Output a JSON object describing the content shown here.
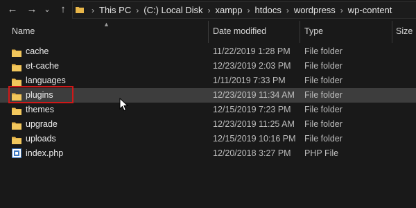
{
  "toolbar": {
    "back_icon": "arrow-left-icon",
    "forward_icon": "arrow-right-icon",
    "recent_icon": "chevron-down-icon",
    "up_icon": "arrow-up-icon"
  },
  "address_bar": {
    "breadcrumbs": [
      "This PC",
      "(C:) Local Disk",
      "xampp",
      "htdocs",
      "wordpress",
      "wp-content"
    ]
  },
  "columns": {
    "name": "Name",
    "date": "Date modified",
    "type": "Type",
    "size": "Size"
  },
  "files": [
    {
      "name": "cache",
      "date": "11/22/2019 1:28 PM",
      "type": "File folder",
      "icon": "folder-icon"
    },
    {
      "name": "et-cache",
      "date": "12/23/2019 2:03 PM",
      "type": "File folder",
      "icon": "folder-icon"
    },
    {
      "name": "languages",
      "date": "1/11/2019 7:33 PM",
      "type": "File folder",
      "icon": "folder-icon"
    },
    {
      "name": "plugins",
      "date": "12/23/2019 11:34 AM",
      "type": "File folder",
      "icon": "folder-icon",
      "selected": true
    },
    {
      "name": "themes",
      "date": "12/15/2019 7:23 PM",
      "type": "File folder",
      "icon": "folder-icon"
    },
    {
      "name": "upgrade",
      "date": "12/23/2019 11:25 AM",
      "type": "File folder",
      "icon": "folder-icon"
    },
    {
      "name": "uploads",
      "date": "12/15/2019 10:16 PM",
      "type": "File folder",
      "icon": "folder-icon"
    },
    {
      "name": "index.php",
      "date": "12/20/2018 3:27 PM",
      "type": "PHP File",
      "icon": "php-file-icon"
    }
  ],
  "colors": {
    "background": "#191919",
    "selected_row": "#3d3d3d",
    "folder": "#e8b649",
    "highlight_box": "#d01818"
  }
}
